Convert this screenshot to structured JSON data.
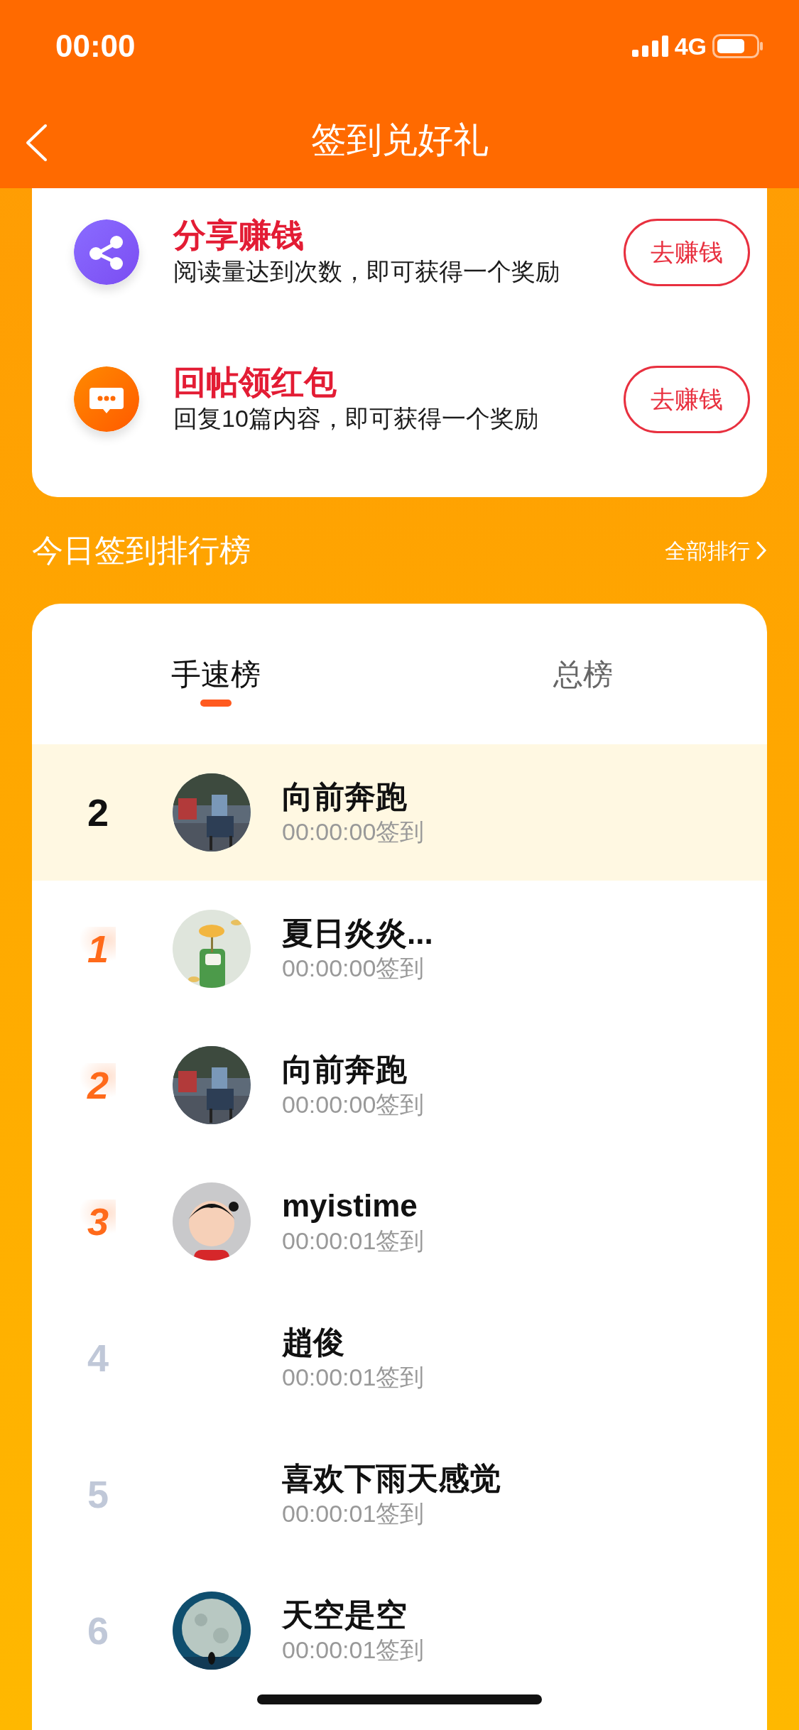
{
  "status_bar": {
    "time": "00:00",
    "network": "4G"
  },
  "nav": {
    "title": "签到兑好礼"
  },
  "tasks": [
    {
      "kind": "share",
      "title": "分享赚钱",
      "desc": "阅读量达到次数，即可获得一个奖励",
      "button": "去赚钱"
    },
    {
      "kind": "reply",
      "title": "回帖领红包",
      "desc": "回复10篇内容，即可获得一个奖励",
      "button": "去赚钱"
    }
  ],
  "ranking": {
    "title": "今日签到排行榜",
    "more": "全部排行",
    "tabs": [
      {
        "label": "手速榜",
        "selected": true
      },
      {
        "label": "总榜",
        "selected": false
      }
    ],
    "rows": [
      {
        "rank": "2",
        "name": "向前奔跑",
        "time": "00:00:00签到",
        "highlighted": true,
        "medal": false
      },
      {
        "rank": "1",
        "name": "夏日炎炎...",
        "time": "00:00:00签到",
        "highlighted": false,
        "medal": true
      },
      {
        "rank": "2",
        "name": "向前奔跑",
        "time": "00:00:00签到",
        "highlighted": false,
        "medal": true
      },
      {
        "rank": "3",
        "name": "myistime",
        "time": "00:00:01签到",
        "highlighted": false,
        "medal": true
      },
      {
        "rank": "4",
        "name": "趙俊",
        "time": "00:00:01签到",
        "highlighted": false,
        "medal": false
      },
      {
        "rank": "5",
        "name": "喜欢下雨天感觉",
        "time": "00:00:01签到",
        "highlighted": false,
        "medal": false
      },
      {
        "rank": "6",
        "name": "天空是空",
        "time": "00:00:01签到",
        "highlighted": false,
        "medal": false
      }
    ]
  }
}
